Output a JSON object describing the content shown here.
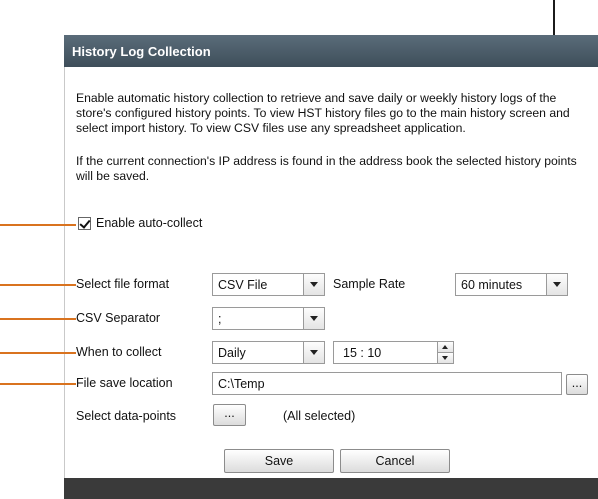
{
  "dialog": {
    "title": "History Log Collection",
    "description_1": "Enable automatic history collection to retrieve and save daily or weekly history logs of the store's configured history points. To view HST history files go to the main history screen and select import history. To view CSV files use any spreadsheet application.",
    "description_2": "If the current connection's IP address is found in the address book the selected history points will be saved."
  },
  "auto_collect": {
    "label": "Enable auto-collect",
    "checked": true
  },
  "file_format": {
    "label": "Select file format",
    "value": "CSV File"
  },
  "sample_rate": {
    "label": "Sample Rate",
    "value": "60 minutes"
  },
  "csv_separator": {
    "label": "CSV Separator",
    "value": ";"
  },
  "when_to_collect": {
    "label": "When to collect",
    "value": "Daily",
    "time": "15 : 10"
  },
  "file_save_location": {
    "label": "File save location",
    "value": "C:\\Temp",
    "browse_label": "..."
  },
  "data_points": {
    "label": "Select data-points",
    "button_label": "...",
    "status": "(All selected)"
  },
  "buttons": {
    "save": "Save",
    "cancel": "Cancel"
  },
  "colors": {
    "annotation_line": "#d9731f",
    "pointer_line": "#1b1b1b",
    "title_bar": "#4a5a66"
  }
}
